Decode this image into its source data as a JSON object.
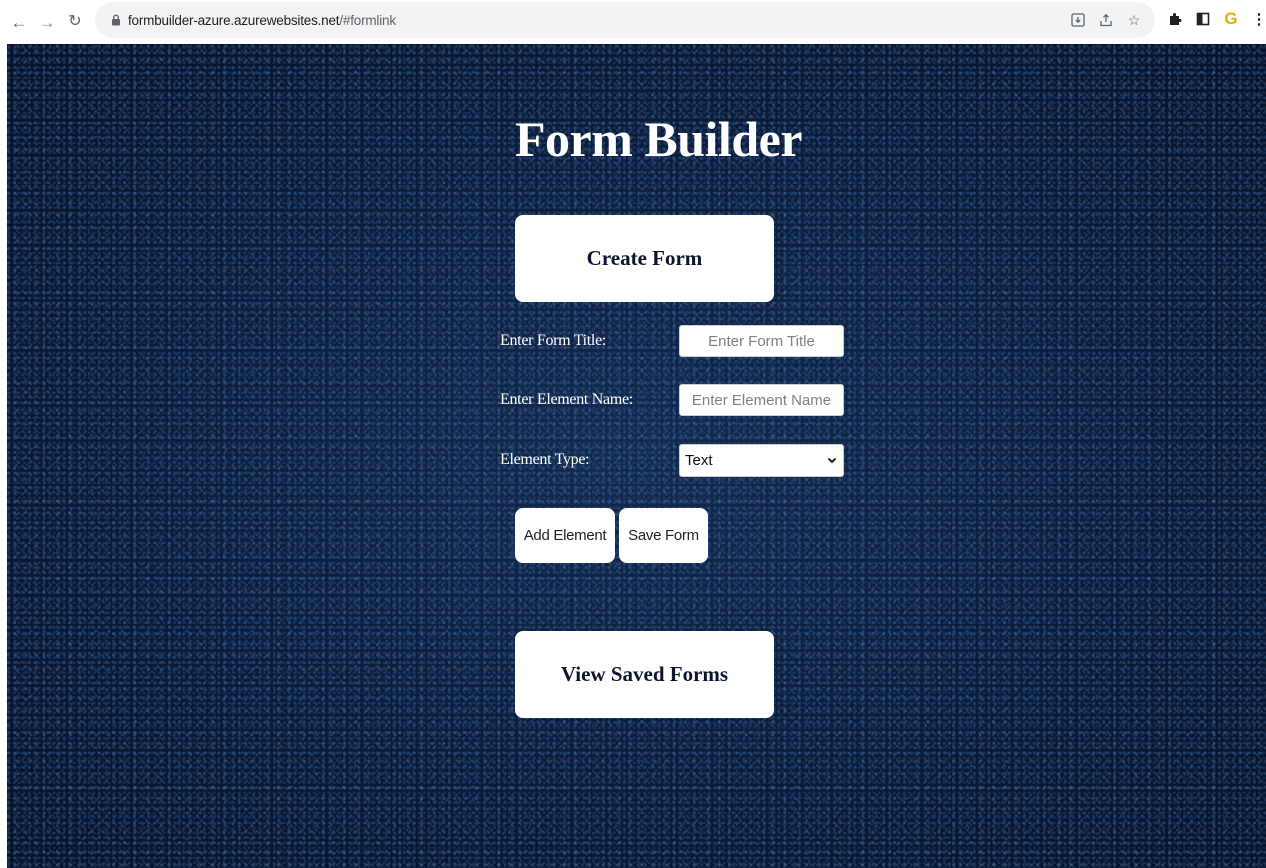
{
  "browser": {
    "url_host": "formbuilder-azure.azurewebsites.net",
    "url_path": "/#formlink",
    "icons": [
      "back-arrow-icon",
      "forward-arrow-icon",
      "reload-icon",
      "lock-icon",
      "install-app-icon",
      "share-icon",
      "bookmark-star-icon",
      "extensions-puzzle-icon",
      "sidebar-panel-icon",
      "g-extension-icon",
      "kebab-menu-icon"
    ]
  },
  "page": {
    "title": "Form Builder",
    "create_button": "Create Form",
    "form_title_label": "Enter Form Title:",
    "form_title_placeholder": "Enter Form Title",
    "element_name_label": "Enter Element Name:",
    "element_name_placeholder": "Enter Element Name",
    "element_type_label": "Element Type:",
    "element_type_selected": "Text",
    "add_element_button": "Add Element",
    "save_form_button": "Save Form",
    "view_saved_button": "View Saved Forms"
  },
  "colors": {
    "background": "#0a1630",
    "button_bg": "#ffffff",
    "title_text": "#ffffff"
  }
}
